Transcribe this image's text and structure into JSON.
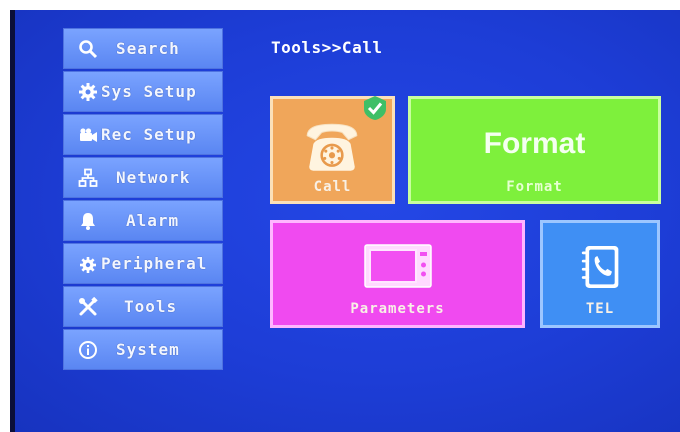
{
  "sidebar": {
    "items": [
      {
        "label": "Search",
        "icon": "search-icon"
      },
      {
        "label": "Sys Setup",
        "icon": "gear-icon"
      },
      {
        "label": "Rec Setup",
        "icon": "camera-icon"
      },
      {
        "label": "Network",
        "icon": "network-icon"
      },
      {
        "label": "Alarm",
        "icon": "bell-icon"
      },
      {
        "label": "Peripheral",
        "icon": "peripheral-gear-icon"
      },
      {
        "label": "Tools",
        "icon": "tools-icon"
      },
      {
        "label": "System",
        "icon": "info-icon"
      }
    ]
  },
  "header": {
    "breadcrumb": "Tools>>Call"
  },
  "tiles": {
    "call": {
      "label": "Call",
      "icon": "telephone-icon",
      "selected": true,
      "color": "#f0a65a"
    },
    "format": {
      "title": "Format",
      "label": "Format",
      "color": "#7ef03c"
    },
    "parameters": {
      "label": "Parameters",
      "icon": "monitor-icon",
      "color": "#f04af0"
    },
    "tel": {
      "label": "TEL",
      "icon": "phonebook-icon",
      "color": "#3f8ff4"
    }
  },
  "colors": {
    "background": "#1d3dd6",
    "menu": "#6a93f8",
    "text": "#ffffff"
  }
}
